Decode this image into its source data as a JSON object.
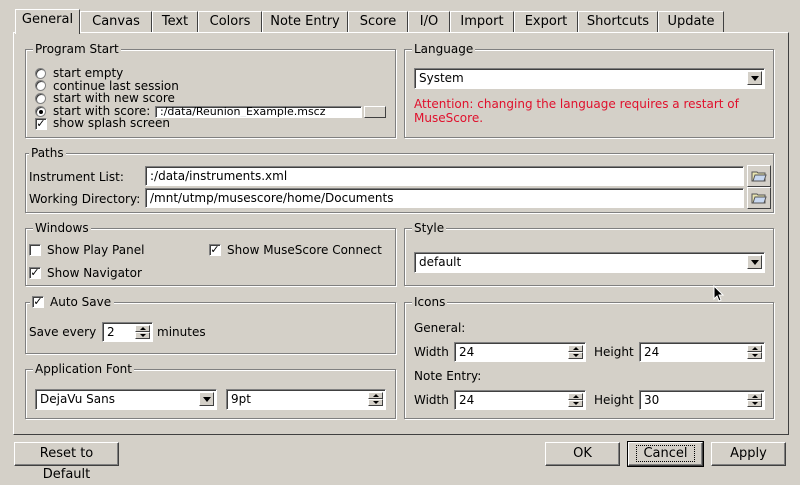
{
  "tabs": [
    "General",
    "Canvas",
    "Text",
    "Colors",
    "Note Entry",
    "Score",
    "I/O",
    "Import",
    "Export",
    "Shortcuts",
    "Update"
  ],
  "program_start": {
    "title": "Program Start",
    "options": [
      "start empty",
      "continue last session",
      "start with new score",
      "start with score:"
    ],
    "score_path": ":/data/Reunion_Example.mscz",
    "splash_label": "show splash screen"
  },
  "language": {
    "title": "Language",
    "selected": "System",
    "warning": "Attention: changing the language requires a restart of MuseScore."
  },
  "paths": {
    "title": "Paths",
    "instrument_label": "Instrument List:",
    "instrument_value": ":/data/instruments.xml",
    "workdir_label": "Working Directory:",
    "workdir_value": "/mnt/utmp/musescore/home/Documents"
  },
  "windows": {
    "title": "Windows",
    "play_panel": "Show Play Panel",
    "navigator": "Show Navigator",
    "connect": "Show MuseScore Connect"
  },
  "style": {
    "title": "Style",
    "selected": "default"
  },
  "autosave": {
    "title": "Auto Save",
    "save_every": "Save every",
    "minutes_value": "2",
    "minutes_label": "minutes"
  },
  "icons": {
    "title": "Icons",
    "general_label": "General:",
    "note_entry_label": "Note Entry:",
    "width_label": "Width",
    "height_label": "Height",
    "general_width": "24",
    "general_height": "24",
    "note_width": "24",
    "note_height": "30"
  },
  "app_font": {
    "title": "Application Font",
    "family": "DejaVu Sans",
    "size": "9pt"
  },
  "buttons": {
    "reset": "Reset to Default",
    "ok": "OK",
    "cancel": "Cancel",
    "apply": "Apply"
  },
  "colors": {
    "background": "#d4d0c8",
    "warning": "#e0102c"
  }
}
